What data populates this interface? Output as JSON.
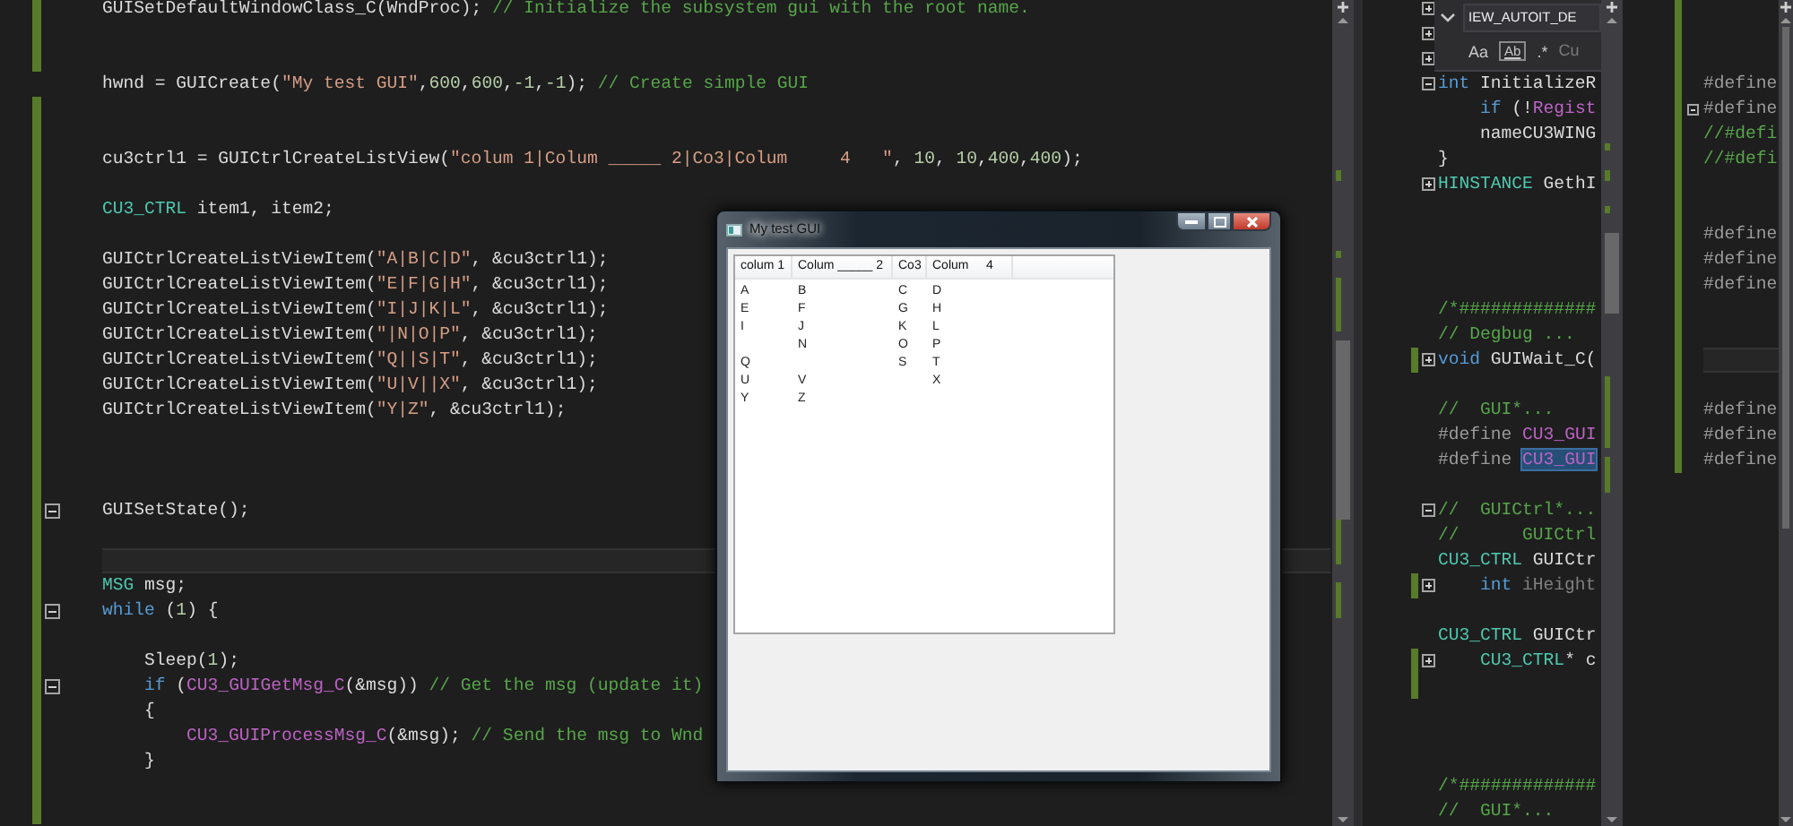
{
  "editor_left": {
    "lines": [
      {
        "kind": "code",
        "changed": true,
        "tokens": [
          {
            "kind": "plain",
            "text": "GUISetDefaultWindowClass_C(WndProc); "
          },
          {
            "kind": "comment",
            "text": "// Initialize the subsystem gui with the root name."
          }
        ]
      },
      {
        "kind": "blank",
        "changed": true
      },
      {
        "kind": "blank",
        "changed": true
      },
      {
        "kind": "code",
        "changed": false,
        "tokens": [
          {
            "kind": "plain",
            "text": "hwnd = GUICreate("
          },
          {
            "kind": "string",
            "text": "\"My test GUI\""
          },
          {
            "kind": "plain",
            "text": ","
          },
          {
            "kind": "number",
            "text": "600"
          },
          {
            "kind": "plain",
            "text": ","
          },
          {
            "kind": "number",
            "text": "600"
          },
          {
            "kind": "plain",
            "text": ","
          },
          {
            "kind": "number",
            "text": "-1"
          },
          {
            "kind": "plain",
            "text": ","
          },
          {
            "kind": "number",
            "text": "-1"
          },
          {
            "kind": "plain",
            "text": "); "
          },
          {
            "kind": "comment",
            "text": "// Create simple GUI"
          }
        ]
      },
      {
        "kind": "blank",
        "changed": true
      },
      {
        "kind": "blank",
        "changed": true
      },
      {
        "kind": "code",
        "changed": true,
        "tokens": [
          {
            "kind": "plain",
            "text": "cu3ctrl1 = GUICtrlCreateListView("
          },
          {
            "kind": "string",
            "text": "\"colum 1|Colum _____ 2|Co3|Colum     4   \""
          },
          {
            "kind": "plain",
            "text": ", "
          },
          {
            "kind": "number",
            "text": "10"
          },
          {
            "kind": "plain",
            "text": ", "
          },
          {
            "kind": "number",
            "text": "10"
          },
          {
            "kind": "plain",
            "text": ","
          },
          {
            "kind": "number",
            "text": "400"
          },
          {
            "kind": "plain",
            "text": ","
          },
          {
            "kind": "number",
            "text": "400"
          },
          {
            "kind": "plain",
            "text": ");"
          }
        ]
      },
      {
        "kind": "blank",
        "changed": true
      },
      {
        "kind": "code",
        "changed": true,
        "tokens": [
          {
            "kind": "type",
            "text": "CU3_CTRL"
          },
          {
            "kind": "plain",
            "text": " item1, item2;"
          }
        ]
      },
      {
        "kind": "blank",
        "changed": true
      },
      {
        "kind": "code",
        "changed": true,
        "tokens": [
          {
            "kind": "plain",
            "text": "GUICtrlCreateListViewItem("
          },
          {
            "kind": "string",
            "text": "\"A|B|C|D\""
          },
          {
            "kind": "plain",
            "text": ", &cu3ctrl1);"
          }
        ]
      },
      {
        "kind": "code",
        "changed": true,
        "tokens": [
          {
            "kind": "plain",
            "text": "GUICtrlCreateListViewItem("
          },
          {
            "kind": "string",
            "text": "\"E|F|G|H\""
          },
          {
            "kind": "plain",
            "text": ", &cu3ctrl1);"
          }
        ]
      },
      {
        "kind": "code",
        "changed": true,
        "tokens": [
          {
            "kind": "plain",
            "text": "GUICtrlCreateListViewItem("
          },
          {
            "kind": "string",
            "text": "\"I|J|K|L\""
          },
          {
            "kind": "plain",
            "text": ", &cu3ctrl1);"
          }
        ]
      },
      {
        "kind": "code",
        "changed": true,
        "tokens": [
          {
            "kind": "plain",
            "text": "GUICtrlCreateListViewItem("
          },
          {
            "kind": "string",
            "text": "\"|N|O|P\""
          },
          {
            "kind": "plain",
            "text": ", &cu3ctrl1);"
          }
        ]
      },
      {
        "kind": "code",
        "changed": true,
        "tokens": [
          {
            "kind": "plain",
            "text": "GUICtrlCreateListViewItem("
          },
          {
            "kind": "string",
            "text": "\"Q||S|T\""
          },
          {
            "kind": "plain",
            "text": ", &cu3ctrl1);"
          }
        ]
      },
      {
        "kind": "code",
        "changed": true,
        "tokens": [
          {
            "kind": "plain",
            "text": "GUICtrlCreateListViewItem("
          },
          {
            "kind": "string",
            "text": "\"U|V||X\""
          },
          {
            "kind": "plain",
            "text": ", &cu3ctrl1);"
          }
        ]
      },
      {
        "kind": "code",
        "changed": true,
        "tokens": [
          {
            "kind": "plain",
            "text": "GUICtrlCreateListViewItem("
          },
          {
            "kind": "string",
            "text": "\"Y|Z\""
          },
          {
            "kind": "plain",
            "text": ", &cu3ctrl1);"
          }
        ]
      },
      {
        "kind": "blank",
        "changed": true
      },
      {
        "kind": "blank",
        "changed": true
      },
      {
        "kind": "blank",
        "changed": true
      },
      {
        "kind": "code",
        "changed": true,
        "collapsed": false,
        "tokens": [
          {
            "kind": "plain",
            "text": "GUISetState();"
          }
        ]
      },
      {
        "kind": "blank",
        "changed": true
      },
      {
        "kind": "current",
        "changed": true
      },
      {
        "kind": "code",
        "changed": true,
        "tokens": [
          {
            "kind": "type",
            "text": "MSG"
          },
          {
            "kind": "plain",
            "text": " msg;"
          }
        ]
      },
      {
        "kind": "code",
        "changed": true,
        "collapsed": false,
        "tokens": [
          {
            "kind": "keyword",
            "text": "while"
          },
          {
            "kind": "plain",
            "text": " ("
          },
          {
            "kind": "number",
            "text": "1"
          },
          {
            "kind": "plain",
            "text": ") {"
          }
        ]
      },
      {
        "kind": "blank",
        "changed": true
      },
      {
        "kind": "code",
        "changed": true,
        "tokens": [
          {
            "kind": "plain",
            "text": "    Sleep("
          },
          {
            "kind": "number",
            "text": "1"
          },
          {
            "kind": "plain",
            "text": ");"
          }
        ]
      },
      {
        "kind": "code",
        "changed": true,
        "collapsed": false,
        "tokens": [
          {
            "kind": "keyword",
            "text": "    if"
          },
          {
            "kind": "plain",
            "text": " ("
          },
          {
            "kind": "macro",
            "text": "CU3_GUIGetMsg_C"
          },
          {
            "kind": "plain",
            "text": "(&msg)) "
          },
          {
            "kind": "comment",
            "text": "// Get the msg (update it)"
          }
        ]
      },
      {
        "kind": "code",
        "changed": true,
        "tokens": [
          {
            "kind": "plain",
            "text": "    {"
          }
        ]
      },
      {
        "kind": "code",
        "changed": true,
        "tokens": [
          {
            "kind": "macro",
            "text": "        CU3_GUIProcessMsg_C"
          },
          {
            "kind": "plain",
            "text": "(&msg); "
          },
          {
            "kind": "comment",
            "text": "// Send the msg to Wnd"
          }
        ]
      },
      {
        "kind": "code",
        "changed": true,
        "tokens": [
          {
            "kind": "plain",
            "text": "    }"
          }
        ]
      },
      {
        "kind": "blank",
        "changed": true
      },
      {
        "kind": "blank",
        "changed": true
      }
    ]
  },
  "dialog": {
    "title": "My test GUI",
    "columns": [
      "colum 1",
      "Colum _____ 2",
      "Co3",
      "Colum     4"
    ],
    "rows": [
      [
        "A",
        "B",
        "C",
        "D"
      ],
      [
        "E",
        "F",
        "G",
        "H"
      ],
      [
        "I",
        "J",
        "K",
        "L"
      ],
      [
        null,
        "N",
        "O",
        "P"
      ],
      [
        "Q",
        null,
        "S",
        "T"
      ],
      [
        "U",
        "V",
        null,
        "X"
      ],
      [
        "Y",
        "Z",
        null,
        null
      ]
    ]
  },
  "editor_middle": {
    "find_widget": {
      "query": "IEW_AUTOIT_DE",
      "options": [
        "Aa",
        "Ab",
        ".*"
      ],
      "scope": "Cu"
    },
    "lines": [
      {
        "kind": "blank",
        "changed": false,
        "collapsed": true
      },
      {
        "kind": "blank",
        "changed": false,
        "collapsed": true
      },
      {
        "kind": "blank",
        "changed": false,
        "collapsed": true
      },
      {
        "kind": "code",
        "changed": false,
        "collapsed": false,
        "tokens": [
          {
            "kind": "keyword",
            "text": "int"
          },
          {
            "kind": "plain",
            "text": " InitializeR"
          }
        ]
      },
      {
        "kind": "code",
        "changed": false,
        "tokens": [
          {
            "kind": "keyword",
            "text": "    if"
          },
          {
            "kind": "plain",
            "text": " (!"
          },
          {
            "kind": "macro",
            "text": "Regist"
          }
        ]
      },
      {
        "kind": "code",
        "changed": false,
        "tokens": [
          {
            "kind": "plain",
            "text": "    nameCU3WING"
          }
        ]
      },
      {
        "kind": "code",
        "changed": false,
        "tokens": [
          {
            "kind": "plain",
            "text": "}"
          }
        ]
      },
      {
        "kind": "code",
        "changed": false,
        "collapsed": true,
        "tokens": [
          {
            "kind": "type",
            "text": "HINSTANCE"
          },
          {
            "kind": "plain",
            "text": " GethI"
          }
        ]
      },
      {
        "kind": "blank",
        "changed": false
      },
      {
        "kind": "blank",
        "changed": false
      },
      {
        "kind": "blank",
        "changed": false
      },
      {
        "kind": "blank",
        "changed": false
      },
      {
        "kind": "code",
        "changed": false,
        "tokens": [
          {
            "kind": "comment",
            "text": "/*#############"
          }
        ]
      },
      {
        "kind": "code",
        "changed": false,
        "tokens": [
          {
            "kind": "comment",
            "text": "// Degbug ..."
          }
        ]
      },
      {
        "kind": "code",
        "changed": true,
        "collapsed": true,
        "tokens": [
          {
            "kind": "keyword",
            "text": "void"
          },
          {
            "kind": "plain",
            "text": " GUIWait_C("
          }
        ]
      },
      {
        "kind": "blank",
        "changed": false
      },
      {
        "kind": "code",
        "changed": false,
        "tokens": [
          {
            "kind": "comment",
            "text": "//  GUI*..."
          }
        ]
      },
      {
        "kind": "code",
        "changed": false,
        "tokens": [
          {
            "kind": "preproc",
            "text": "#define "
          },
          {
            "kind": "macro",
            "text": "CU3_GUI"
          }
        ]
      },
      {
        "kind": "code",
        "changed": false,
        "tokens": [
          {
            "kind": "preproc",
            "text": "#define "
          },
          {
            "kind": "highlighted",
            "text": "CU3_GUI"
          }
        ]
      },
      {
        "kind": "blank",
        "changed": false
      },
      {
        "kind": "code",
        "changed": false,
        "collapsed": false,
        "tokens": [
          {
            "kind": "comment",
            "text": "//  GUICtrl*..."
          }
        ]
      },
      {
        "kind": "code",
        "changed": false,
        "tokens": [
          {
            "kind": "comment",
            "text": "//      GUICtrl"
          }
        ]
      },
      {
        "kind": "code",
        "changed": false,
        "tokens": [
          {
            "kind": "type",
            "text": "CU3_CTRL"
          },
          {
            "kind": "plain",
            "text": " GUICtr"
          }
        ]
      },
      {
        "kind": "code",
        "changed": true,
        "collapsed": true,
        "tokens": [
          {
            "kind": "keyword",
            "text": "    int"
          },
          {
            "kind": "dim",
            "text": " iHeight"
          }
        ]
      },
      {
        "kind": "blank",
        "changed": false
      },
      {
        "kind": "code",
        "changed": false,
        "tokens": [
          {
            "kind": "type",
            "text": "CU3_CTRL"
          },
          {
            "kind": "plain",
            "text": " GUICtr"
          }
        ]
      },
      {
        "kind": "code",
        "changed": true,
        "collapsed": true,
        "tokens": [
          {
            "kind": "type",
            "text": "    CU3_CTRL"
          },
          {
            "kind": "plain",
            "text": "* c"
          }
        ]
      },
      {
        "kind": "blank",
        "changed": true
      },
      {
        "kind": "blank",
        "changed": false
      },
      {
        "kind": "blank",
        "changed": false
      },
      {
        "kind": "blank",
        "changed": false
      },
      {
        "kind": "code",
        "changed": false,
        "tokens": [
          {
            "kind": "comment",
            "text": "/*#############"
          }
        ]
      },
      {
        "kind": "code",
        "changed": false,
        "tokens": [
          {
            "kind": "comment",
            "text": "//  GUI*..."
          }
        ]
      }
    ]
  },
  "editor_right": {
    "lines": [
      {
        "kind": "blank",
        "changed": true
      },
      {
        "kind": "blank",
        "changed": true
      },
      {
        "kind": "blank",
        "changed": true
      },
      {
        "kind": "code",
        "changed": true,
        "tokens": [
          {
            "kind": "preproc",
            "text": "#define"
          }
        ]
      },
      {
        "kind": "code",
        "changed": true,
        "collapsed": false,
        "tokens": [
          {
            "kind": "preproc",
            "text": "#define"
          }
        ]
      },
      {
        "kind": "code",
        "changed": true,
        "tokens": [
          {
            "kind": "comment",
            "text": "//#defi"
          }
        ]
      },
      {
        "kind": "code",
        "changed": true,
        "tokens": [
          {
            "kind": "comment",
            "text": "//#defi"
          }
        ]
      },
      {
        "kind": "blank",
        "changed": true
      },
      {
        "kind": "blank",
        "changed": true
      },
      {
        "kind": "code",
        "changed": true,
        "tokens": [
          {
            "kind": "preproc",
            "text": "#define"
          }
        ]
      },
      {
        "kind": "code",
        "changed": true,
        "tokens": [
          {
            "kind": "preproc",
            "text": "#define"
          }
        ]
      },
      {
        "kind": "code",
        "changed": true,
        "tokens": [
          {
            "kind": "preproc",
            "text": "#define"
          }
        ]
      },
      {
        "kind": "blank",
        "changed": true
      },
      {
        "kind": "blank",
        "changed": true
      },
      {
        "kind": "current",
        "changed": true
      },
      {
        "kind": "blank",
        "changed": true
      },
      {
        "kind": "code",
        "changed": true,
        "tokens": [
          {
            "kind": "preproc",
            "text": "#define"
          }
        ]
      },
      {
        "kind": "code",
        "changed": true,
        "tokens": [
          {
            "kind": "preproc",
            "text": "#define"
          }
        ]
      },
      {
        "kind": "code",
        "changed": true,
        "tokens": [
          {
            "kind": "preproc",
            "text": "#define"
          }
        ]
      }
    ]
  }
}
